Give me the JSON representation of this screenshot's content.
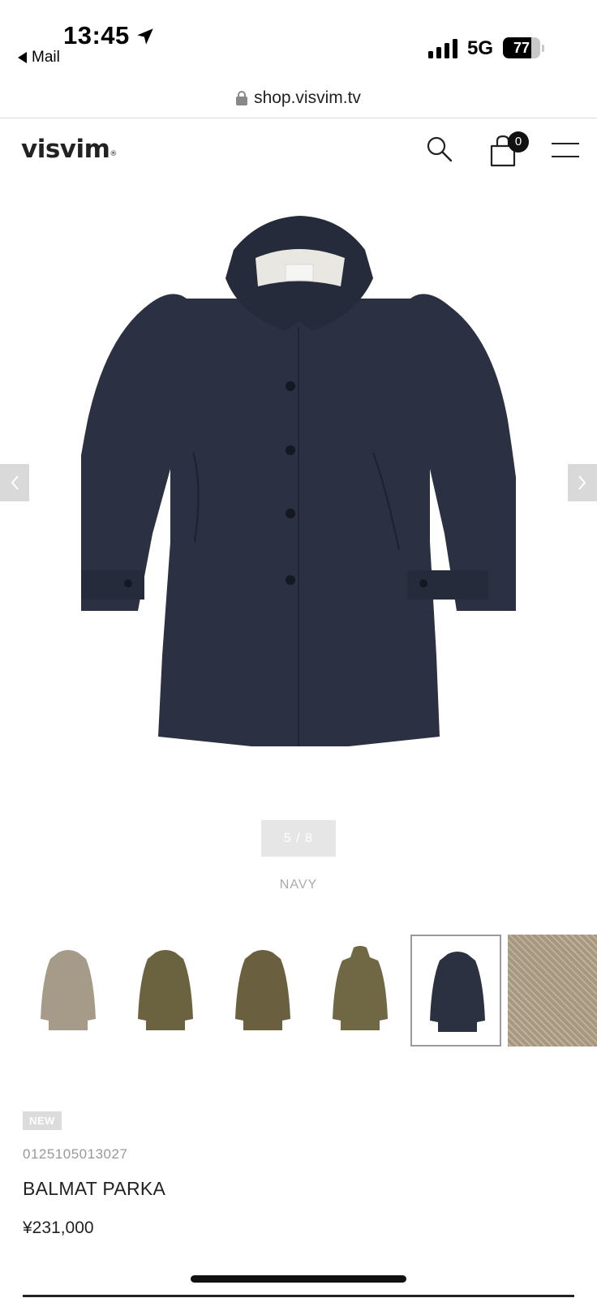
{
  "status_bar": {
    "time": "13:45",
    "back_app": "Mail",
    "network": "5G",
    "battery": "77",
    "battery_level": 0.77
  },
  "browser": {
    "url": "shop.visvim.tv"
  },
  "header": {
    "logo": "visvim",
    "logo_mark": "®",
    "cart_count": "0"
  },
  "gallery": {
    "counter": "5 / 8",
    "color_name": "NAVY",
    "thumbnails": [
      {
        "color": "#a59b88"
      },
      {
        "color": "#6b6240"
      },
      {
        "color": "#6a5f3e"
      },
      {
        "color": "#706844"
      },
      {
        "color": "#2c3142",
        "selected": true
      },
      {
        "color": "#b2a38e",
        "swatch": true
      }
    ]
  },
  "product": {
    "badge": "NEW",
    "sku": "0125105013027",
    "name": "BALMAT PARKA",
    "price": "¥231,000"
  },
  "colors": {
    "coat_navy": "#2b3042",
    "accent_dark": "#111111"
  }
}
